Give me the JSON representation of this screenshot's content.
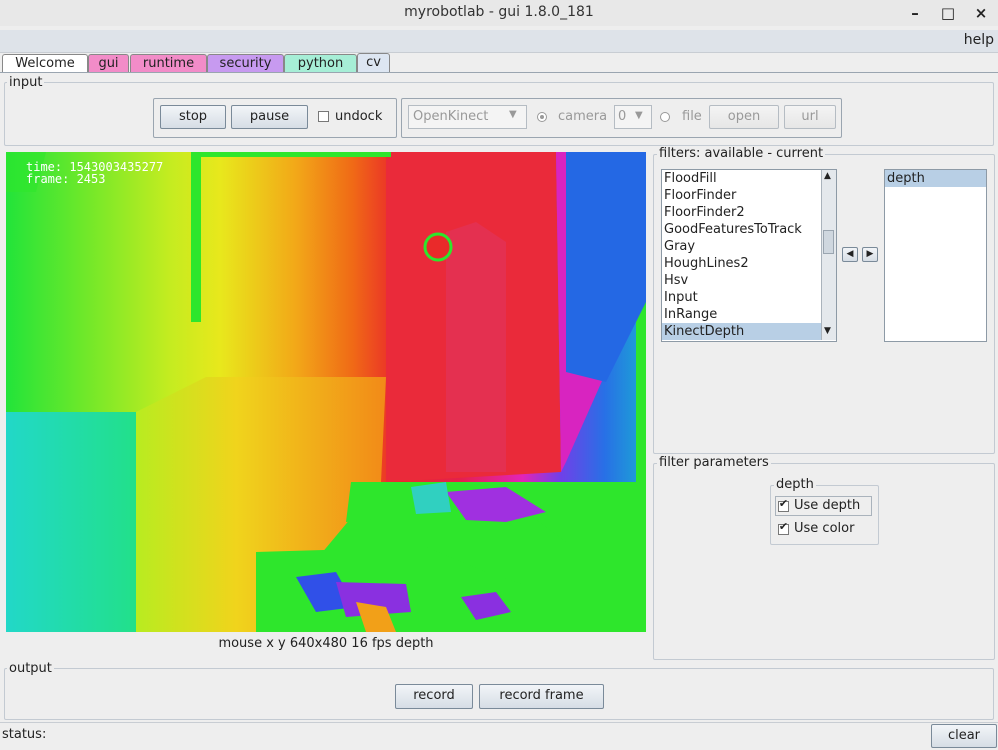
{
  "window": {
    "title": "myrobotlab - gui 1.8.0_181"
  },
  "menu": {
    "help": "help"
  },
  "tabs": [
    {
      "label": "Welcome",
      "color": "#ffffff"
    },
    {
      "label": "gui",
      "color": "#f28cc8"
    },
    {
      "label": "runtime",
      "color": "#f28cc8"
    },
    {
      "label": "security",
      "color": "#c79af0"
    },
    {
      "label": "python",
      "color": "#a6eed6"
    },
    {
      "label": "cv",
      "color": "#dde6f2"
    }
  ],
  "input": {
    "legend": "input",
    "stop": "stop",
    "pause": "pause",
    "undock": "undock",
    "grabber": "OpenKinect",
    "camera_label": "camera",
    "camera_index": "0",
    "file_label": "file",
    "open": "open",
    "url": "url"
  },
  "video": {
    "time": "time:  1543003435277",
    "frame": "frame:  2453",
    "status": "mouse x y  640x480  16 fps  depth"
  },
  "filters": {
    "legend": "filters: available - current",
    "available": [
      "FloodFill",
      "FloorFinder",
      "FloorFinder2",
      "GoodFeaturesToTrack",
      "Gray",
      "HoughLines2",
      "Hsv",
      "Input",
      "InRange",
      "KinectDepth"
    ],
    "selected_available": "KinectDepth",
    "current": [
      "depth"
    ]
  },
  "params": {
    "legend": "filter parameters",
    "group": "depth",
    "use_depth": "Use depth",
    "use_color": "Use color"
  },
  "output": {
    "legend": "output",
    "record": "record",
    "record_frame": "record frame"
  },
  "status": {
    "label": "status:",
    "clear": "clear"
  }
}
